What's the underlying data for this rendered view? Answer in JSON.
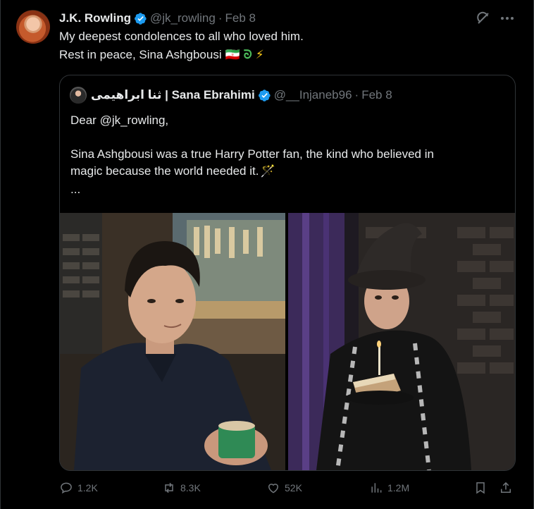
{
  "tweet": {
    "author": "J.K. Rowling",
    "handle": "@jk_rowling",
    "separator": "·",
    "date": "Feb 8",
    "line1": "My deepest condolences to all who loved him.",
    "line2": "Rest in peace, Sina Ashgbousi",
    "line2_emoji_flag": "🇮🇷",
    "line2_emoji_snake": "ᘐ",
    "line2_emoji_bolt": "⚡"
  },
  "quote": {
    "author": "ثنا ابراهیمی | Sana Ebrahimi",
    "handle": "@__Injaneb96",
    "separator": "·",
    "date": "Feb 8",
    "line1": "Dear @jk_rowling,",
    "line2": "Sina Ashgbousi was a true Harry Potter fan, the kind who believed in",
    "line3": "magic because the world needed it.",
    "line3_emoji": "🪄",
    "more": "..."
  },
  "actions": {
    "replies": "1.2K",
    "reposts": "8.3K",
    "likes": "52K",
    "views": "1.2M"
  },
  "colors": {
    "background": "#000000",
    "text": "#e7e9ea",
    "muted": "#71767b",
    "border": "#2f3336",
    "verified": "#1d9bf0"
  },
  "icons": [
    "verified-badge-icon",
    "grok-icon",
    "more-icon",
    "reply-icon",
    "repost-icon",
    "like-icon",
    "views-icon",
    "bookmark-icon",
    "share-icon"
  ]
}
